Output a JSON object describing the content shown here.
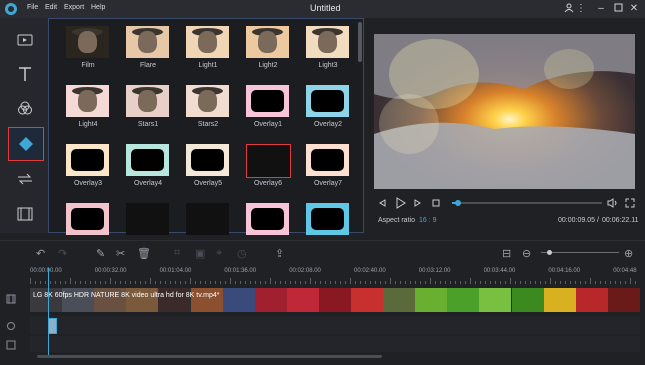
{
  "app": {
    "title": "Untitled"
  },
  "menu": [
    "File",
    "Edit",
    "Export",
    "Help"
  ],
  "window_controls": [
    "user-icon",
    "more-icon",
    "minimize-icon",
    "maximize-icon",
    "close-icon"
  ],
  "sidebar": {
    "items": [
      {
        "name": "media-icon",
        "active": false
      },
      {
        "name": "text-icon",
        "active": false
      },
      {
        "name": "filters-icon",
        "active": false
      },
      {
        "name": "overlays-icon",
        "active": true
      },
      {
        "name": "transitions-icon",
        "active": false
      },
      {
        "name": "elements-icon",
        "active": false
      }
    ]
  },
  "overlays": [
    {
      "label": "Film"
    },
    {
      "label": "Flare"
    },
    {
      "label": "Light1"
    },
    {
      "label": "Light2"
    },
    {
      "label": "Light3"
    },
    {
      "label": "Light4"
    },
    {
      "label": "Stars1"
    },
    {
      "label": "Stars2"
    },
    {
      "label": "Overlay1"
    },
    {
      "label": "Overlay2"
    },
    {
      "label": "Overlay3"
    },
    {
      "label": "Overlay4"
    },
    {
      "label": "Overlay5"
    },
    {
      "label": "Overlay6"
    },
    {
      "label": "Overlay7"
    },
    {
      "label": ""
    },
    {
      "label": ""
    },
    {
      "label": ""
    },
    {
      "label": ""
    },
    {
      "label": ""
    }
  ],
  "player": {
    "aspect_label": "Aspect ratio",
    "aspect_value": "16 : 9",
    "current_time": "00:00:09.05",
    "separator": "/",
    "total_time": "00:06:22.11",
    "progress": 0.04
  },
  "timeline": {
    "ticks": [
      "00:00:00.00",
      "00:00:32.00",
      "00:01:04.00",
      "00:01:36.00",
      "00:02:08.00",
      "00:02:40.00",
      "00:03:12.00",
      "00:03:44.00",
      "00:04:16.00",
      "00:04:48"
    ],
    "clip_label": "LG 8K 60fps HDR NATURE 8K video ultra hd for 8K tv.mp4*",
    "zoom_level": 0.1
  },
  "colors": {
    "accent": "#3fa7d6",
    "active_border": "#e23b3b"
  }
}
